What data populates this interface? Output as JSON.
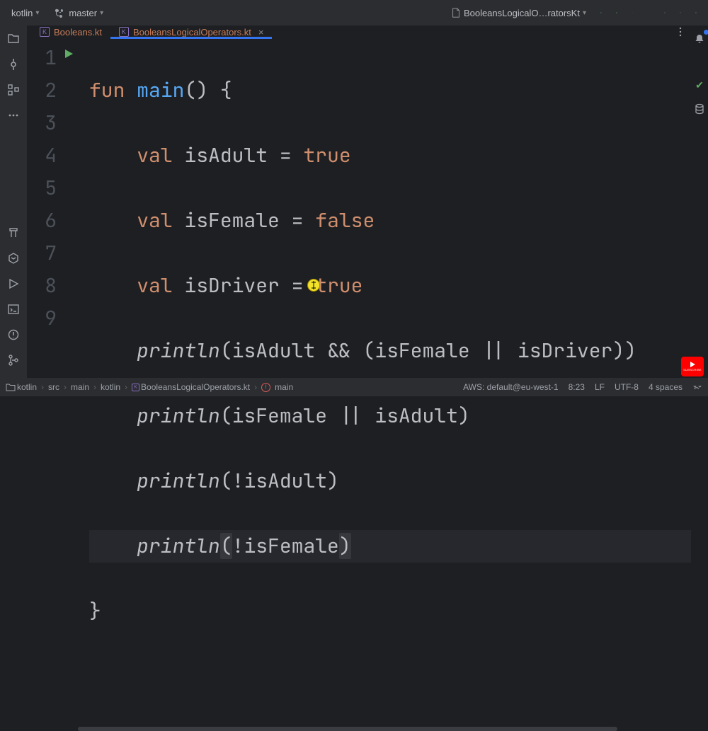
{
  "topbar": {
    "project_name": "kotlin",
    "branch_label": "master",
    "run_config_label": "BooleansLogicalO…ratorsKt"
  },
  "tabs": [
    {
      "label": "Booleans.kt",
      "active": false
    },
    {
      "label": "BooleansLogicalOperators.kt",
      "active": true
    }
  ],
  "editor": {
    "line_count": 9,
    "active_line": 8,
    "tokens": {
      "fun": "fun",
      "main": "main",
      "open": "()",
      "brace_o": "{",
      "brace_c": "}",
      "val": "val",
      "isAdult": "isAdult",
      "isFemale": "isFemale",
      "isDriver": "isDriver",
      "eq": "=",
      "true": "true",
      "false": "false",
      "println": "println",
      "and": "&&",
      "or": "||",
      "not": "!"
    },
    "lines_plain": [
      "fun main() {",
      "    val isAdult = true",
      "    val isFemale = false",
      "    val isDriver = true",
      "    println(isAdult && (isFemale || isDriver))",
      "    println(isFemale || isAdult)",
      "    println(!isAdult)",
      "    println(!isFemale)",
      "}"
    ]
  },
  "breadcrumbs": {
    "parts": [
      "kotlin",
      "src",
      "main",
      "kotlin",
      "BooleansLogicalOperators.kt"
    ],
    "symbol": "main"
  },
  "status": {
    "aws": "AWS: default@eu-west-1",
    "caret": "8:23",
    "line_ending": "LF",
    "encoding": "UTF-8",
    "indent": "4 spaces"
  },
  "youtube": {
    "label": "SUBSCRIBE"
  }
}
